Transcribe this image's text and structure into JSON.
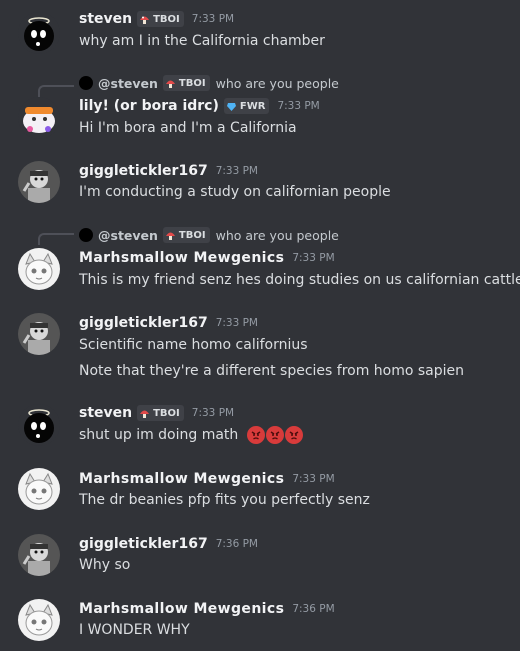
{
  "tags": {
    "tboi": "TBOI",
    "fwr": "FWR"
  },
  "messages": [
    {
      "user": "steven",
      "tag": "TBOI",
      "time": "7:33 PM",
      "text": "why am I in the California chamber"
    },
    {
      "reply_to": "@steven",
      "reply_tag": "TBOI",
      "reply_text": "who are you people",
      "user": "lily! (or bora idrc)",
      "tag": "FWR",
      "time": "7:33 PM",
      "text": "Hi I'm bora and I'm a California"
    },
    {
      "user": "giggletickler167",
      "time": "7:33 PM",
      "text": "I'm conducting a study on californian people"
    },
    {
      "reply_to": "@steven",
      "reply_tag": "TBOI",
      "reply_text": "who are you people",
      "user": "Marhsmallow Mewgenics",
      "time": "7:33 PM",
      "text": "This is my friend senz hes doing studies on us californian cattle"
    },
    {
      "user": "giggletickler167",
      "time": "7:33 PM",
      "text": "Scientific name homo californius",
      "text2": "Note that they're a different species from homo sapien"
    },
    {
      "user": "steven",
      "tag": "TBOI",
      "time": "7:33 PM",
      "text": "shut up im doing math",
      "emoji": "angry-face-emoji x3"
    },
    {
      "user": "Marhsmallow Mewgenics",
      "time": "7:33 PM",
      "text": "The dr beanies pfp fits you perfectly senz"
    },
    {
      "user": "giggletickler167",
      "time": "7:36 PM",
      "text": "Why so"
    },
    {
      "user": "Marhsmallow Mewgenics",
      "time": "7:36 PM",
      "text": "I WONDER WHY"
    }
  ]
}
